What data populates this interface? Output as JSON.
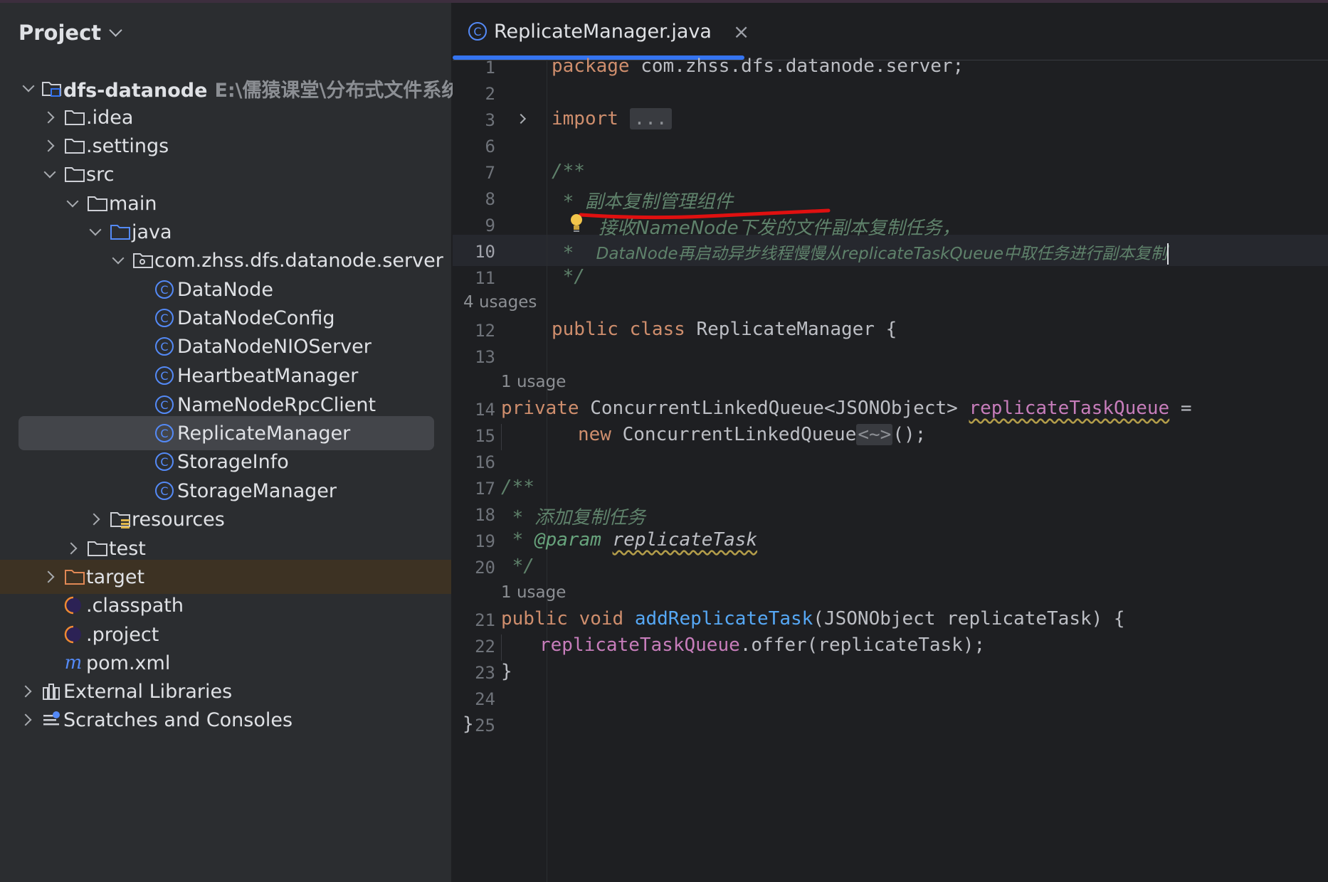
{
  "project": {
    "title": "Project",
    "items": [
      {
        "label": "dfs-datanode",
        "hint": "E:\\儒猿课堂\\分布式文件系统\\",
        "icon": "module-folder-icon"
      },
      {
        "label": ".idea",
        "icon": "folder-icon"
      },
      {
        "label": ".settings",
        "icon": "folder-icon"
      },
      {
        "label": "src",
        "icon": "folder-icon"
      },
      {
        "label": "main",
        "icon": "folder-icon"
      },
      {
        "label": "java",
        "icon": "source-folder-icon"
      },
      {
        "label": "com.zhss.dfs.datanode.server",
        "icon": "package-icon"
      },
      {
        "label": "DataNode",
        "icon": "class-icon"
      },
      {
        "label": "DataNodeConfig",
        "icon": "class-icon"
      },
      {
        "label": "DataNodeNIOServer",
        "icon": "class-icon"
      },
      {
        "label": "HeartbeatManager",
        "icon": "class-icon"
      },
      {
        "label": "NameNodeRpcClient",
        "icon": "class-icon"
      },
      {
        "label": "ReplicateManager",
        "icon": "class-icon"
      },
      {
        "label": "StorageInfo",
        "icon": "class-icon"
      },
      {
        "label": "StorageManager",
        "icon": "class-icon"
      },
      {
        "label": "resources",
        "icon": "resources-folder-icon"
      },
      {
        "label": "test",
        "icon": "folder-icon"
      },
      {
        "label": "target",
        "icon": "excluded-folder-icon"
      },
      {
        "label": ".classpath",
        "icon": "eclipse-icon"
      },
      {
        "label": ".project",
        "icon": "eclipse-icon"
      },
      {
        "label": "pom.xml",
        "icon": "maven-icon"
      },
      {
        "label": "External Libraries",
        "icon": "library-icon"
      },
      {
        "label": "Scratches and Consoles",
        "icon": "scratches-icon"
      }
    ]
  },
  "editor": {
    "tab": {
      "label": "ReplicateManager.java"
    },
    "line_numbers": [
      "1",
      "2",
      "3",
      "6",
      "7",
      "8",
      "9",
      "10",
      "11",
      "12",
      "13",
      "14",
      "15",
      "16",
      "17",
      "18",
      "19",
      "20",
      "21",
      "22",
      "23",
      "24",
      "25"
    ],
    "code": {
      "l1_kw": "package",
      "l1_rest": " com.zhss.dfs.datanode.server;",
      "l3_kw": "import",
      "l3_fold": "...",
      "l7": "/**",
      "l8_star": " * ",
      "l8_text": "副本复制管理组件",
      "l9_text": "接收NameNode下发的文件副本复制任务，",
      "l10_star": " *  ",
      "l10_text": "DataNode再启动异步线程慢慢从replicateTaskQueue中取任务进行副本复制",
      "l11": " */",
      "usages_class": "4 usages",
      "l12_kw": "public class",
      "l12_rest": " ReplicateManager {",
      "usage_field": "1 usage",
      "l14_kw": "private",
      "l14_type": " ConcurrentLinkedQueue<JSONObject> ",
      "l14_field": "replicateTaskQueue",
      "l14_end": " =",
      "l15_kw": "new",
      "l15_type": " ConcurrentLinkedQueue",
      "l15_diamond": "<~>",
      "l15_end": "();",
      "l17": "/**",
      "l18_star": " * ",
      "l18_text": "添加复制任务",
      "l19_star": " * ",
      "l19_tag": "@param",
      "l19_sp": " ",
      "l19_param": "replicateTask",
      "l20": " */",
      "usage_method": "1 usage",
      "l21_kw": "public void",
      "l21_sp": " ",
      "l21_fn": "addReplicateTask",
      "l21_rest": "(JSONObject replicateTask) {",
      "l22_field": "replicateTaskQueue",
      "l22_rest": ".offer(replicateTask);",
      "l23": "}",
      "l25": "}"
    }
  },
  "colors": {
    "accent": "#3574f0",
    "keyword": "#cf8e6d",
    "doc_comment": "#5f826b",
    "field": "#c77dbb",
    "method": "#56a8f5",
    "annotation_underline": "#e01010"
  }
}
